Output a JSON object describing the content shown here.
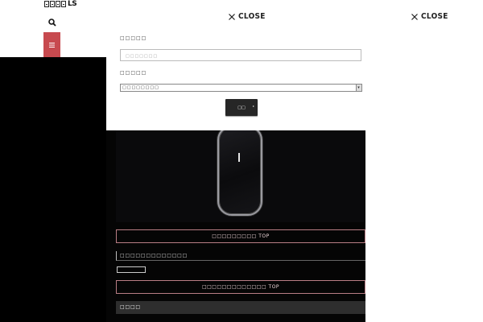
{
  "header": {
    "logo_suffix": "LS"
  },
  "overlay": {
    "close_label": "CLOSE",
    "close_label_right": "CLOSE"
  },
  "form": {
    "field1_label": "□□□□□",
    "field1_value": "□□□□□□□",
    "field2_label": "□□□□□",
    "select_value": "□□□□□□□□",
    "submit_label": "□□"
  },
  "content": {
    "button1_label": "□□□□□□□□□ TOP",
    "section_title": "□□□□□□□□□□□□□",
    "button2_label": "□□□□□□□□□□□□□ TOP",
    "bar_label": "□□□□"
  },
  "colors": {
    "menu_red": "#c74a4f",
    "button_border": "#b87d84"
  }
}
